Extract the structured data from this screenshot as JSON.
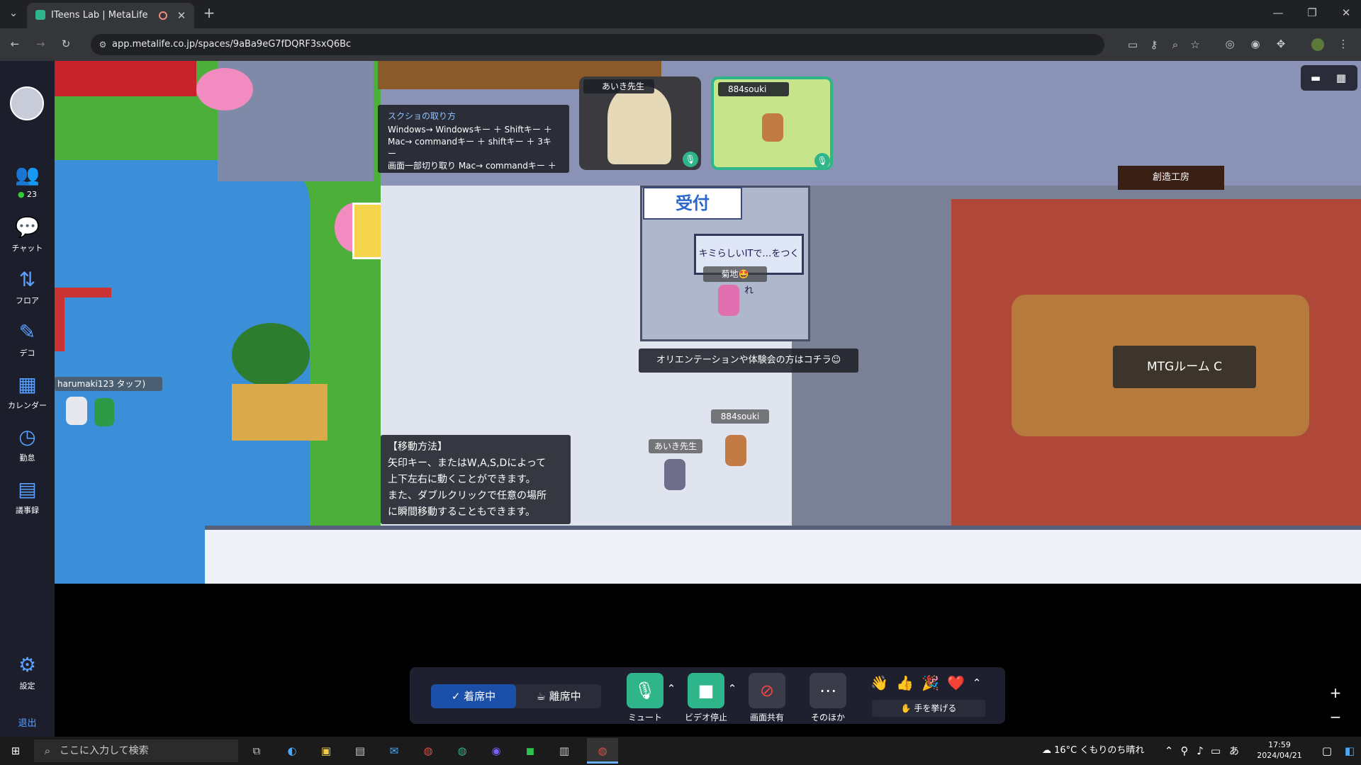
{
  "browser": {
    "tab_title": "ITeens Lab | MetaLife",
    "url": "app.metalife.co.jp/spaces/9aBa9eG7fDQRF3sxQ6Bc"
  },
  "sidebar": {
    "items": [
      {
        "label": "23",
        "icon": "people-icon"
      },
      {
        "label": "チャット",
        "icon": "chat-icon"
      },
      {
        "label": "フロア",
        "icon": "floor-icon"
      },
      {
        "label": "デコ",
        "icon": "deco-icon"
      },
      {
        "label": "カレンダー",
        "icon": "calendar-icon"
      },
      {
        "label": "勤怠",
        "icon": "clock-icon"
      },
      {
        "label": "議事録",
        "icon": "document-icon"
      },
      {
        "label": "設定",
        "icon": "gear-icon"
      },
      {
        "label": "退出",
        "icon": ""
      }
    ]
  },
  "map": {
    "screenshot_tip": {
      "title": "スクショの取り方",
      "lines": [
        "Windows→ Windowsキー ＋ Shiftキー ＋",
        "Mac→ commandキー ＋ shiftキー ＋ 3キー",
        "画面一部切り取り Mac→ commandキー ＋"
      ]
    },
    "video_tiles": [
      {
        "name": "あいき先生"
      },
      {
        "name": "884souki"
      }
    ],
    "reception_sign": "受付",
    "board_text": "キミらしいITで…をつくれ",
    "player_kikuchi": "菊地🤩",
    "orientation_banner": "オリエンテーションや体験会の方はコチラ☺",
    "movement_help": {
      "title": "【移動方法】",
      "lines": [
        "矢印キー、またはW,A,S,Dによって",
        "上下左右に動くことができます。",
        "また、ダブルクリックで任意の場所",
        "に瞬間移動することもできます。"
      ]
    },
    "avatar_labels": [
      "884souki",
      "あいき先生",
      "harumaki123 タッフ)"
    ],
    "room_label": "MTGルーム C",
    "room_sign": "創造工房"
  },
  "toolbar": {
    "status_on": "着席中",
    "status_off": "離席中",
    "mute": "ミュート",
    "video_stop": "ビデオ停止",
    "screen_share": "画面共有",
    "more": "そのほか",
    "raise_hand": "✋ 手を挙げる",
    "reactions": [
      "👋",
      "👍",
      "🎉",
      "❤️"
    ]
  },
  "taskbar": {
    "search_placeholder": "ここに入力して検索",
    "weather": "16°C くもりのち晴れ",
    "time": "17:59",
    "date": "2024/04/21",
    "ime": "あ"
  }
}
